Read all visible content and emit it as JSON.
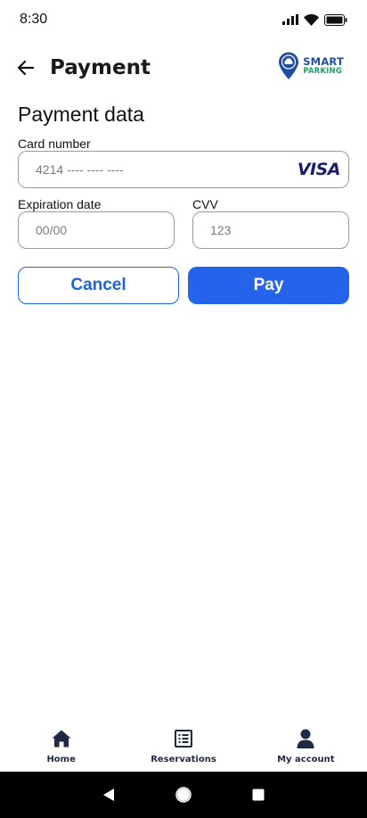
{
  "status_bar": {
    "time": "8:30"
  },
  "header": {
    "title": "Payment",
    "logo_line1": "SMART",
    "logo_line2": "PARKING"
  },
  "form": {
    "section_title": "Payment data",
    "card_number_label": "Card number",
    "card_number_placeholder": "4214 ---- ---- ----",
    "card_brand": "VISA",
    "expiration_label": "Expiration date",
    "expiration_placeholder": "00/00",
    "cvv_label": "CVV",
    "cvv_placeholder": "123"
  },
  "buttons": {
    "cancel_label": "Cancel",
    "pay_label": "Pay"
  },
  "bottom_nav": {
    "items": [
      {
        "label": "Home",
        "icon": "home-icon"
      },
      {
        "label": "Reservations",
        "icon": "list-icon"
      },
      {
        "label": "My account",
        "icon": "person-icon"
      }
    ]
  },
  "colors": {
    "primary": "#2563eb",
    "nav_text": "#1e2a44",
    "logo_blue": "#1d4ea3",
    "logo_green": "#1aa36a"
  }
}
